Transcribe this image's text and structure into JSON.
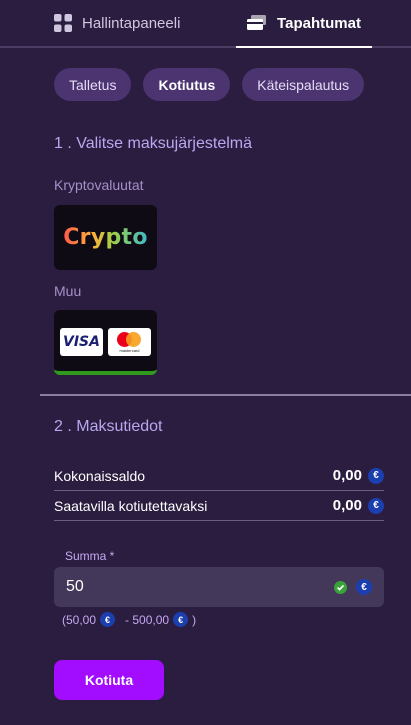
{
  "nav": {
    "dashboard_label": "Hallintapaneeli",
    "events_label": "Tapahtumat"
  },
  "tabs": [
    "Talletus",
    "Kotiutus",
    "Käteispalautus"
  ],
  "active_tab": "Kotiutus",
  "step1": {
    "title": "1 . Valitse maksujärjestelmä",
    "crypto_label": "Kryptovaluutat",
    "crypto_logo": "Crypto",
    "other_label": "Muu",
    "visa_text": "VISA",
    "mastercard_text": "mastercard"
  },
  "step2": {
    "title": "2 . Maksutiedot",
    "balances": [
      {
        "label": "Kokonaissaldo",
        "value": "0,00"
      },
      {
        "label": "Saatavilla kotiutettavaksi",
        "value": "0,00"
      }
    ],
    "amount_label": "Summa *",
    "amount_value": "50",
    "limits": {
      "open": "(50,00",
      "dash": "- 500,00",
      "close": ")"
    },
    "currency_symbol": "€",
    "submit_label": "Kotiuta"
  },
  "colors": {
    "background": "#2a1d3f",
    "accent": "#a20cff",
    "pill": "#4b3470",
    "euro_badge": "#1c3fb0"
  }
}
